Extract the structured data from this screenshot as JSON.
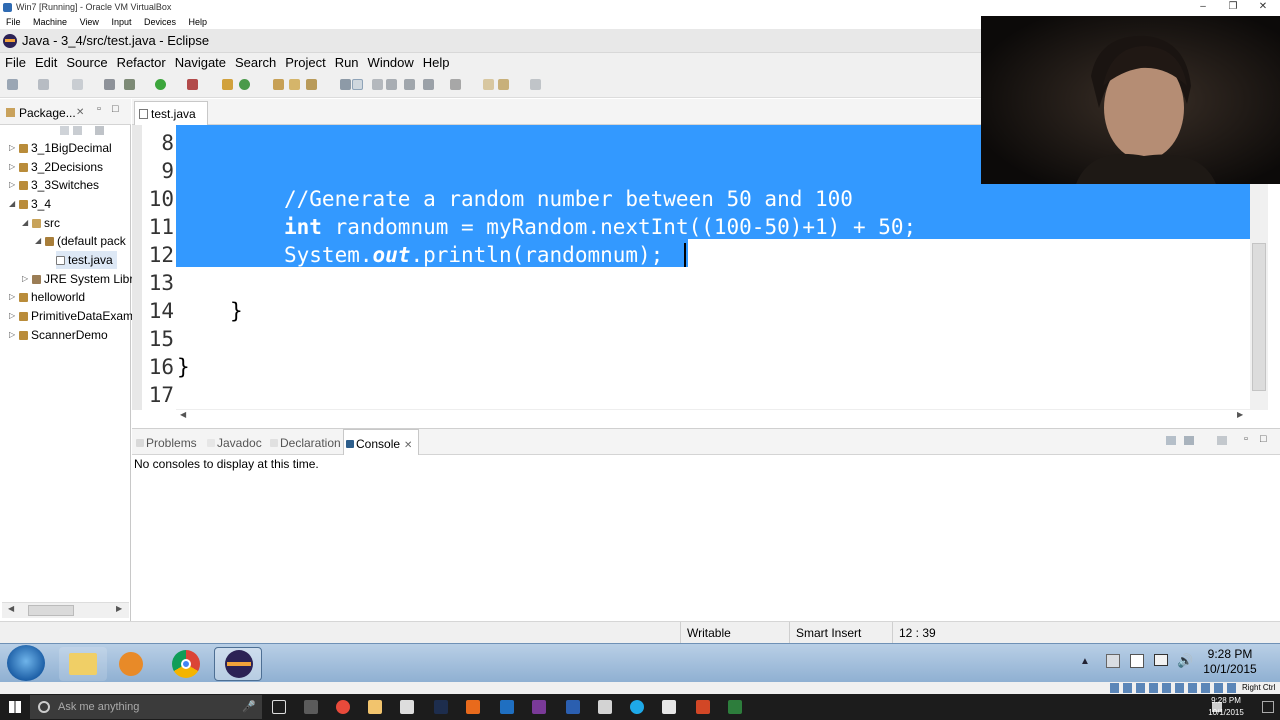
{
  "vbox": {
    "title": "Win7 [Running] - Oracle VM VirtualBox",
    "menu": [
      "File",
      "Machine",
      "View",
      "Input",
      "Devices",
      "Help"
    ],
    "status_right": "Right Ctrl"
  },
  "eclipse": {
    "title": "Java - 3_4/src/test.java - Eclipse",
    "menu": [
      "File",
      "Edit",
      "Source",
      "Refactor",
      "Navigate",
      "Search",
      "Project",
      "Run",
      "Window",
      "Help"
    ]
  },
  "package_explorer": {
    "tab_label": "Package...",
    "items": [
      {
        "label": "3_1BigDecimal"
      },
      {
        "label": "3_2Decisions"
      },
      {
        "label": "3_3Switches"
      },
      {
        "label": "3_4"
      },
      {
        "label": "src"
      },
      {
        "label": "(default pack"
      },
      {
        "label": "test.java"
      },
      {
        "label": "JRE System Libr"
      },
      {
        "label": "helloworld"
      },
      {
        "label": "PrimitiveDataExam"
      },
      {
        "label": "ScannerDemo"
      }
    ]
  },
  "editor": {
    "tab_label": "test.java",
    "line_numbers": [
      "8",
      "9",
      "10",
      "11",
      "12",
      "13",
      "14",
      "15",
      "16",
      "17"
    ],
    "lines": {
      "l10": "//Generate a random number between 50 and 100",
      "l11_kw": "int",
      "l11_rest": " randomnum = myRandom.nextInt((100-50)+1) + 50;",
      "l12_a": "System.",
      "l12_b": "out",
      "l12_c": ".println(randomnum);",
      "l14": "}",
      "l16": "}"
    }
  },
  "console": {
    "tabs": [
      "Problems",
      "Javadoc",
      "Declaration",
      "Console"
    ],
    "active_tab": "Console",
    "message": "No consoles to display at this time."
  },
  "statusbar": {
    "writable": "Writable",
    "insert_mode": "Smart Insert",
    "position": "12 : 39"
  },
  "vm_taskbar": {
    "time": "9:28 PM",
    "date": "10/1/2015"
  },
  "host_taskbar": {
    "search_placeholder": "Ask me anything",
    "time": "9:28 PM",
    "date": "10/1/2015"
  }
}
